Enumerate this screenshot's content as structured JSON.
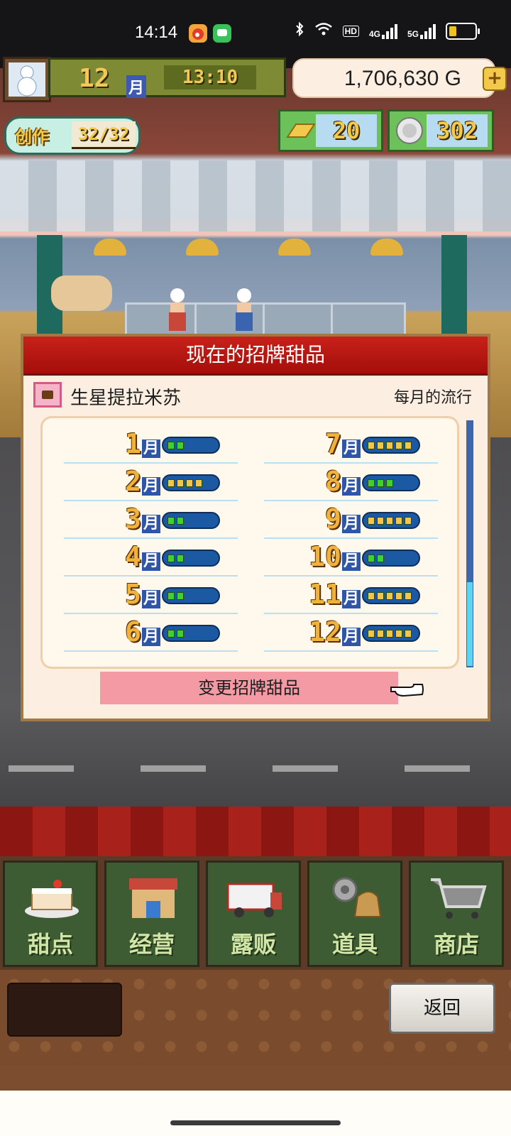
{
  "status_bar": {
    "time": "14:14",
    "icons": [
      "weibo-icon",
      "wechat-icon",
      "bluetooth-icon",
      "wifi-icon",
      "hd-icon",
      "signal-4g-icon",
      "signal-5g-icon",
      "battery-icon"
    ],
    "hd_label": "HD",
    "net1": "4G",
    "net2": "5G"
  },
  "hud": {
    "month": "12",
    "month_unit": "月",
    "clock": "13:10",
    "gold": "1,706,630 G",
    "create_label": "创作",
    "create_count": "32/32",
    "gold_bars": "20",
    "medals": "302"
  },
  "panel": {
    "title": "现在的招牌甜品",
    "dessert_name": "生星提拉米苏",
    "trend_label": "每月的流行",
    "month_unit": "月",
    "months": [
      {
        "label": "1",
        "level": 2
      },
      {
        "label": "2",
        "level": 4
      },
      {
        "label": "3",
        "level": 2
      },
      {
        "label": "4",
        "level": 2
      },
      {
        "label": "5",
        "level": 2
      },
      {
        "label": "6",
        "level": 2
      },
      {
        "label": "7",
        "level": 5
      },
      {
        "label": "8",
        "level": 3
      },
      {
        "label": "9",
        "level": 5
      },
      {
        "label": "10",
        "level": 2
      },
      {
        "label": "11",
        "level": 5
      },
      {
        "label": "12",
        "level": 5
      }
    ],
    "level_max": 5,
    "change_button": "变更招牌甜品"
  },
  "nav": {
    "items": [
      {
        "label": "甜点",
        "icon": "cake-icon"
      },
      {
        "label": "经营",
        "icon": "shop-building-icon"
      },
      {
        "label": "露贩",
        "icon": "food-truck-icon"
      },
      {
        "label": "道具",
        "icon": "gear-bag-icon"
      },
      {
        "label": "商店",
        "icon": "shopping-cart-icon"
      }
    ],
    "back_button": "返回"
  },
  "colors": {
    "header_red": "#b8160f",
    "level_green": "#3fd12f",
    "level_yellow": "#f2c64a",
    "nav_green": "#3d5c33"
  }
}
